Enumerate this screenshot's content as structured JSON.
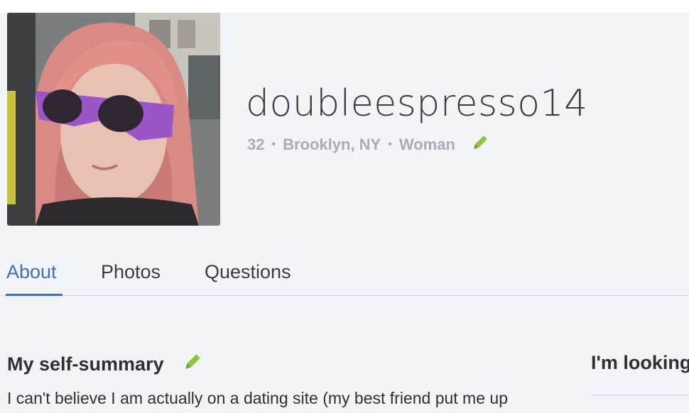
{
  "profile": {
    "username": "doubleespresso14",
    "age": "32",
    "location": "Brooklyn, NY",
    "gender": "Woman",
    "separator": "•"
  },
  "tabs": [
    {
      "label": "About",
      "active": true
    },
    {
      "label": "Photos",
      "active": false
    },
    {
      "label": "Questions",
      "active": false
    }
  ],
  "sections": {
    "self_summary_title": "My self-summary",
    "self_summary_text": "I can't believe I am actually on a dating site (my best friend put me up",
    "looking_for_title": "I'm looking"
  },
  "colors": {
    "accent": "#3f6fc1",
    "edit_icon": "#8cc63f",
    "meta_text": "#a9adb9",
    "background": "#f3f4f8"
  },
  "icons": {
    "edit": "pencil-icon"
  }
}
